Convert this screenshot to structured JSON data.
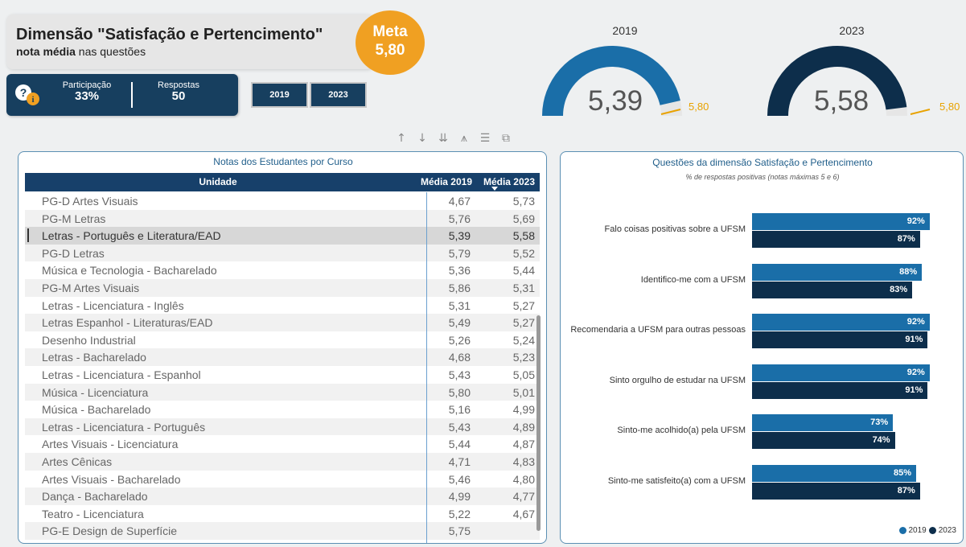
{
  "header": {
    "title": "Dimensão \"Satisfação e Pertencimento\"",
    "subtitle_bold": "nota média",
    "subtitle_rest": " nas questões",
    "meta_label": "Meta",
    "meta_value": "5,80"
  },
  "kpis": {
    "participacao_label": "Participação",
    "participacao_value": "33%",
    "respostas_label": "Respostas",
    "respostas_value": "50"
  },
  "year_buttons": [
    "2019",
    "2023"
  ],
  "gauges": [
    {
      "year": "2019",
      "value": "5,39",
      "target": "5,80",
      "fill_fraction": 0.93,
      "color": "#1a6ea8"
    },
    {
      "year": "2023",
      "value": "5,58",
      "target": "5,80",
      "fill_fraction": 0.96,
      "color": "#0d2e4b"
    }
  ],
  "toolbar_icons": [
    "sort-up-icon",
    "sort-down-icon",
    "expand-all-icon",
    "drill-icon",
    "filter-icon",
    "focus-mode-icon"
  ],
  "table": {
    "title": "Notas dos Estudantes por Curso",
    "columns": [
      "Unidade",
      "Média 2019",
      "Média 2023"
    ],
    "rows": [
      [
        "PG-D Artes Visuais",
        "4,67",
        "5,73"
      ],
      [
        "PG-M Letras",
        "5,76",
        "5,69"
      ],
      [
        "Letras - Português e Literatura/EAD",
        "5,39",
        "5,58"
      ],
      [
        "PG-D Letras",
        "5,79",
        "5,52"
      ],
      [
        "Música e Tecnologia - Bacharelado",
        "5,36",
        "5,44"
      ],
      [
        "PG-M Artes Visuais",
        "5,86",
        "5,31"
      ],
      [
        "Letras - Licenciatura - Inglês",
        "5,31",
        "5,27"
      ],
      [
        "Letras Espanhol - Literaturas/EAD",
        "5,49",
        "5,27"
      ],
      [
        "Desenho Industrial",
        "5,26",
        "5,24"
      ],
      [
        "Letras - Bacharelado",
        "4,68",
        "5,23"
      ],
      [
        "Letras - Licenciatura - Espanhol",
        "5,43",
        "5,05"
      ],
      [
        "Música - Licenciatura",
        "5,80",
        "5,01"
      ],
      [
        "Música - Bacharelado",
        "5,16",
        "4,99"
      ],
      [
        "Letras - Licenciatura - Português",
        "5,43",
        "4,89"
      ],
      [
        "Artes Visuais - Licenciatura",
        "5,44",
        "4,87"
      ],
      [
        "Artes Cênicas",
        "4,71",
        "4,83"
      ],
      [
        "Artes Visuais - Bacharelado",
        "5,46",
        "4,80"
      ],
      [
        "Dança - Bacharelado",
        "4,99",
        "4,77"
      ],
      [
        "Teatro - Licenciatura",
        "5,22",
        "4,67"
      ],
      [
        "PG-E Design de Superfície",
        "5,75",
        ""
      ]
    ],
    "selected_row": 2
  },
  "chart": {
    "title": "Questões da dimensão Satisfação e Pertencimento",
    "subtitle": "% de respostas positivas (notas máximas 5 e 6)",
    "legend": [
      "2019",
      "2023"
    ],
    "colors": {
      "2019": "#1a6ea8",
      "2023": "#0d2e4b"
    }
  },
  "chart_data": {
    "type": "bar",
    "orientation": "horizontal",
    "categories": [
      "Falo coisas positivas sobre a UFSM",
      "Identifico-me com a UFSM",
      "Recomendaria a UFSM para outras pessoas",
      "Sinto orgulho de estudar na UFSM",
      "Sinto-me acolhido(a) pela UFSM",
      "Sinto-me satisfeito(a) com a UFSM"
    ],
    "series": [
      {
        "name": "2019",
        "values": [
          92,
          88,
          92,
          92,
          73,
          85
        ],
        "labels": [
          "92%",
          "88%",
          "92%",
          "92%",
          "73%",
          "85%"
        ]
      },
      {
        "name": "2023",
        "values": [
          87,
          83,
          91,
          91,
          74,
          87
        ],
        "labels": [
          "87%",
          "83%",
          "91%",
          "91%",
          "74%",
          "87%"
        ]
      }
    ],
    "unit": "%",
    "legend_position": "bottom-right"
  }
}
